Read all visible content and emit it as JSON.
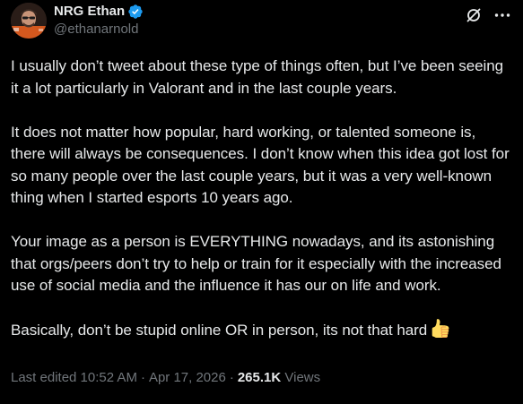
{
  "author": {
    "display_name": "NRG Ethan",
    "handle": "@ethanarnold",
    "verified": true,
    "verified_color": "#1d9bf0"
  },
  "header_actions": {
    "grok_icon": "grok-icon",
    "more_icon": "more-icon"
  },
  "tweet": {
    "paragraphs": [
      "I usually don’t tweet about these type of things often, but I’ve been seeing it a lot particularly in Valorant and in the last couple years.",
      "It does not matter how popular, hard working, or talented someone is, there will always be consequences. I don’t know when this idea got lost for so many people over the last couple years, but it was a very well-known thing when I started esports 10 years ago.",
      "Your image as a person is EVERYTHING nowadays, and its astonishing that orgs/peers don’t try to help or train for it especially with the increased use of social media and the influence it has our on life and work.",
      "Basically, don’t be stupid online OR in person, its not that hard"
    ],
    "trailing_emoji": "thumbs-up-icon"
  },
  "meta": {
    "edited_label": "Last edited 10:52 AM",
    "separator": "·",
    "date": "Apr 17, 2026",
    "views_count": "265.1K",
    "views_label": "Views"
  },
  "colors": {
    "background": "#000000",
    "text_primary": "#e7e9ea",
    "text_secondary": "#71767b",
    "accent": "#1d9bf0"
  }
}
